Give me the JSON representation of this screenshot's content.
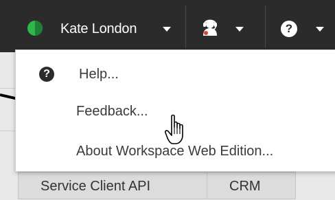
{
  "header": {
    "user_name": "Kate London",
    "status": "ready",
    "icons": {
      "status": "status-ready-icon",
      "agent": "agent-headset-icon",
      "help": "help-icon"
    },
    "help_glyph": "?",
    "colors": {
      "bar": "#2b2b2b",
      "status_green": "#2db84b"
    }
  },
  "help_menu": {
    "items": [
      {
        "label": "Help...",
        "icon": "help-icon"
      },
      {
        "label": "Feedback..."
      },
      {
        "label": "About Workspace Web Edition..."
      }
    ],
    "hovered_item": "Feedback..."
  },
  "background": {
    "tabs": [
      {
        "label": "Service Client API"
      },
      {
        "label": "CRM"
      }
    ]
  },
  "cursor": "hand-pointer-icon"
}
